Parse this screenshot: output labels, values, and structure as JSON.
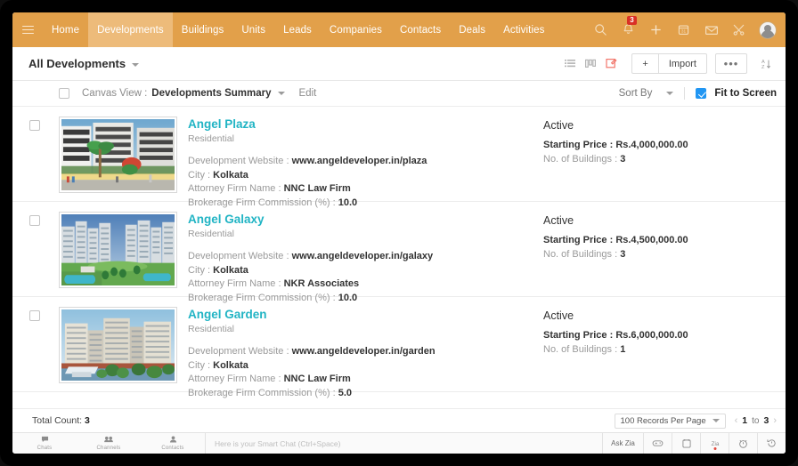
{
  "topnav": {
    "menu_icon": "hamburger-icon",
    "items": [
      {
        "label": "Home",
        "active": false
      },
      {
        "label": "Developments",
        "active": true
      },
      {
        "label": "Buildings",
        "active": false
      },
      {
        "label": "Units",
        "active": false
      },
      {
        "label": "Leads",
        "active": false
      },
      {
        "label": "Companies",
        "active": false
      },
      {
        "label": "Contacts",
        "active": false
      },
      {
        "label": "Deals",
        "active": false
      },
      {
        "label": "Activities",
        "active": false
      }
    ],
    "icons": [
      "search-icon",
      "notification-bell-icon",
      "add-icon",
      "calendar-icon",
      "mail-icon",
      "tools-icon",
      "user-avatar"
    ],
    "notification_count": "3",
    "accent_color": "#e2a04a",
    "active_tab_color": "#edbb7a"
  },
  "module_header": {
    "title": "All Developments",
    "view_icons": [
      "list-view-icon",
      "kanban-view-icon",
      "canvas-view-icon"
    ],
    "active_view": "canvas-view-icon",
    "active_view_color": "#f2766b",
    "create_label": "+",
    "import_label": "Import",
    "more_label": "•••",
    "sort_alpha_icon": "sort-alpha-icon"
  },
  "canvas_bar": {
    "select_all_checked": false,
    "canvas_label": "Canvas View :",
    "canvas_value": "Developments Summary",
    "edit_label": "Edit",
    "sort_by_label": "Sort By",
    "fit_to_screen_label": "Fit to Screen",
    "fit_to_screen_checked": true,
    "checkbox_color": "#2196f3"
  },
  "records": [
    {
      "checked": false,
      "title": "Angel Plaza",
      "title_color": "#21b4c4",
      "subtitle": "Residential",
      "thumbnail": "angel-plaza-building-photo",
      "fields": [
        {
          "label": "Development Website :",
          "value": "www.angeldeveloper.in/plaza"
        },
        {
          "label": "City :",
          "value": "Kolkata"
        },
        {
          "label": "Attorney Firm Name :",
          "value": "NNC Law Firm"
        },
        {
          "label": "Brokerage Firm Commission (%) :",
          "value": "10.0"
        }
      ],
      "status": "Active",
      "right_fields": [
        {
          "label": "Starting Price :",
          "value": "Rs.4,000,000.00",
          "bold": true
        },
        {
          "label": "No. of Buildings :",
          "value": "3",
          "bold": false
        }
      ]
    },
    {
      "checked": false,
      "title": "Angel Galaxy",
      "title_color": "#21b4c4",
      "subtitle": "Residential",
      "thumbnail": "angel-galaxy-building-photo",
      "fields": [
        {
          "label": "Development Website :",
          "value": "www.angeldeveloper.in/galaxy"
        },
        {
          "label": "City :",
          "value": "Kolkata"
        },
        {
          "label": "Attorney Firm Name :",
          "value": "NKR Associates"
        },
        {
          "label": "Brokerage Firm Commission (%) :",
          "value": "10.0"
        }
      ],
      "status": "Active",
      "right_fields": [
        {
          "label": "Starting Price :",
          "value": "Rs.4,500,000.00",
          "bold": true
        },
        {
          "label": "No. of Buildings :",
          "value": "3",
          "bold": false
        }
      ]
    },
    {
      "checked": false,
      "title": "Angel Garden",
      "title_color": "#21b4c4",
      "subtitle": "Residential",
      "thumbnail": "angel-garden-building-photo",
      "fields": [
        {
          "label": "Development Website :",
          "value": "www.angeldeveloper.in/garden"
        },
        {
          "label": "City :",
          "value": "Kolkata"
        },
        {
          "label": "Attorney Firm Name :",
          "value": "NNC Law Firm"
        },
        {
          "label": "Brokerage Firm Commission (%) :",
          "value": "5.0"
        }
      ],
      "status": "Active",
      "right_fields": [
        {
          "label": "Starting Price :",
          "value": "Rs.6,000,000.00",
          "bold": true
        },
        {
          "label": "No. of Buildings :",
          "value": "1",
          "bold": false
        }
      ]
    }
  ],
  "footer": {
    "total_count_label": "Total Count:",
    "total_count_value": "3",
    "records_per_page": "100 Records Per Page",
    "page_from": "1",
    "page_to_label": "to",
    "page_to": "3",
    "prev_arrow": "‹",
    "next_arrow": "›"
  },
  "dock": {
    "tabs": [
      {
        "label": "Chats",
        "icon": "chat-bubble-icon",
        "glyph": "●"
      },
      {
        "label": "Channels",
        "icon": "channels-icon",
        "glyph": "●"
      },
      {
        "label": "Contacts",
        "icon": "contacts-icon",
        "glyph": "●"
      }
    ],
    "chat_placeholder": "Here is your Smart Chat (Ctrl+Space)",
    "ask_zia_label": "Ask Zia",
    "buttons": [
      "game-controller-icon",
      "calendar-bell-icon",
      "zia-notification-icon",
      "alarm-clock-icon",
      "history-clock-icon"
    ]
  }
}
